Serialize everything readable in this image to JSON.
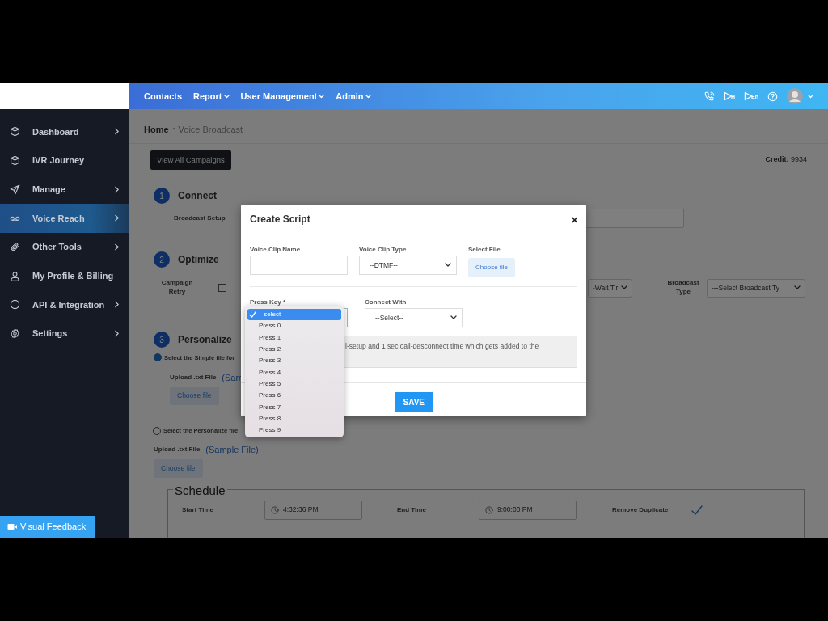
{
  "topnav": {
    "items": [
      {
        "label": "Contacts",
        "dropdown": false
      },
      {
        "label": "Report",
        "dropdown": true
      },
      {
        "label": "User Management",
        "dropdown": true
      },
      {
        "label": "Admin",
        "dropdown": true
      }
    ],
    "icon_badges": [
      "H",
      "En"
    ]
  },
  "sidebar": {
    "items": [
      {
        "label": "Dashboard",
        "chevron": true,
        "selected": false
      },
      {
        "label": "IVR Journey",
        "chevron": false,
        "selected": false
      },
      {
        "label": "Manage",
        "chevron": true,
        "selected": false
      },
      {
        "label": "Voice Reach",
        "chevron": true,
        "selected": true
      },
      {
        "label": "Other Tools",
        "chevron": true,
        "selected": false
      },
      {
        "label": "My Profile & Billing",
        "chevron": false,
        "selected": false
      },
      {
        "label": "API & Integration",
        "chevron": true,
        "selected": false
      },
      {
        "label": "Settings",
        "chevron": true,
        "selected": false
      }
    ]
  },
  "feedback_button": "Visual Feedback",
  "breadcrumb": [
    "Home",
    "Voice Broadcast"
  ],
  "view_all_button": "View All Campaigns",
  "credit": {
    "label": "Credit:",
    "value": "9934"
  },
  "steps": [
    {
      "number": "1",
      "title": "Connect"
    },
    {
      "number": "2",
      "title": "Optimize"
    },
    {
      "number": "3",
      "title": "Personalize"
    }
  ],
  "connect": {
    "label": "Broadcast Setup"
  },
  "optimize": {
    "retry_label": "Campaign Retry",
    "retry_checked": false,
    "wait_select": "-Wait Tir",
    "broadcast_type_label": "Broadcast Type",
    "broadcast_type_select": "---Select Broadcast Ty"
  },
  "personalize": {
    "options": [
      {
        "label": "Select the Simple file for",
        "selected": true,
        "upload_label": "Upload .txt File",
        "sample_link": "(Sam",
        "choose_button": "Choose file"
      },
      {
        "label": "Select the Personalize file",
        "selected": false,
        "upload_label": "Upload .txt File",
        "sample_link": "(Sample File)",
        "choose_button": "Choose file"
      }
    ]
  },
  "schedule": {
    "legend": "Schedule",
    "start_label": "Start Time",
    "start_value": "4:32:36 PM",
    "end_label": "End Time",
    "end_value": "9:00:00 PM",
    "remove_duplicate_label": "Remove Duplicate",
    "remove_duplicate_checked": true
  },
  "modal": {
    "title": "Create Script",
    "close": "×",
    "clip_name_label": "Voice Clip Name",
    "clip_type_label": "Voice Clip Type",
    "clip_type_value": "--DTMF--",
    "file_label": "Select File",
    "file_button": "Choose file",
    "press_key_label": "Press Key *",
    "connect_label": "Connect With",
    "connect_value": "--Select--",
    "info": "l-setup and 1 sec call-desconnect time which gets added to the",
    "save_button": "SAVE",
    "dropdown": {
      "options": [
        {
          "label": "--select--",
          "selected": true
        },
        {
          "label": "Press 0",
          "selected": false
        },
        {
          "label": "Press 1",
          "selected": false
        },
        {
          "label": "Press 2",
          "selected": false
        },
        {
          "label": "Press 3",
          "selected": false
        },
        {
          "label": "Press 4",
          "selected": false
        },
        {
          "label": "Press 5",
          "selected": false
        },
        {
          "label": "Press 6",
          "selected": false
        },
        {
          "label": "Press 7",
          "selected": false
        },
        {
          "label": "Press 8",
          "selected": false
        },
        {
          "label": "Press 9",
          "selected": false
        }
      ]
    }
  }
}
